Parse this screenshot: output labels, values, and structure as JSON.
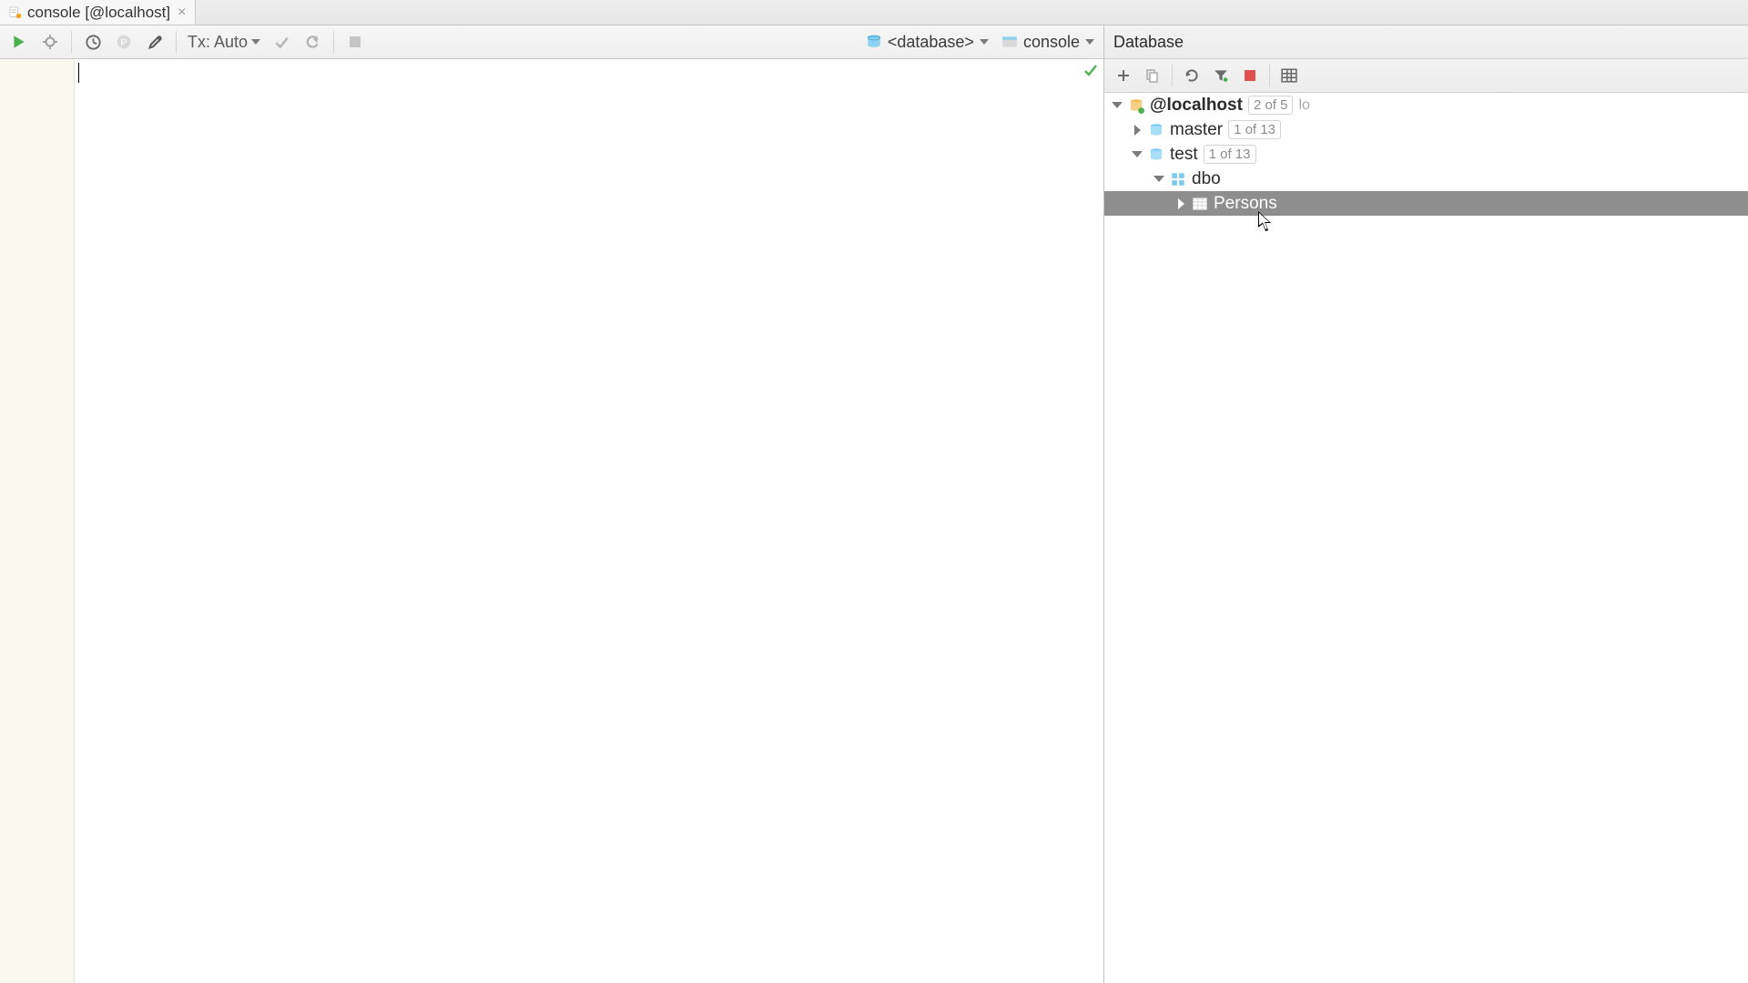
{
  "tab": {
    "label": "console [@localhost]"
  },
  "toolbar": {
    "tx_label": "Tx: Auto",
    "schema_label": "<database>",
    "console_label": "console"
  },
  "database": {
    "title": "Database",
    "tree": {
      "root": {
        "label": "@localhost",
        "badge": "2 of 5",
        "tail": "lo"
      },
      "master": {
        "label": "master",
        "badge": "1 of 13"
      },
      "test": {
        "label": "test",
        "badge": "1 of 13"
      },
      "dbo": {
        "label": "dbo"
      },
      "persons": {
        "label": "Persons"
      }
    }
  }
}
